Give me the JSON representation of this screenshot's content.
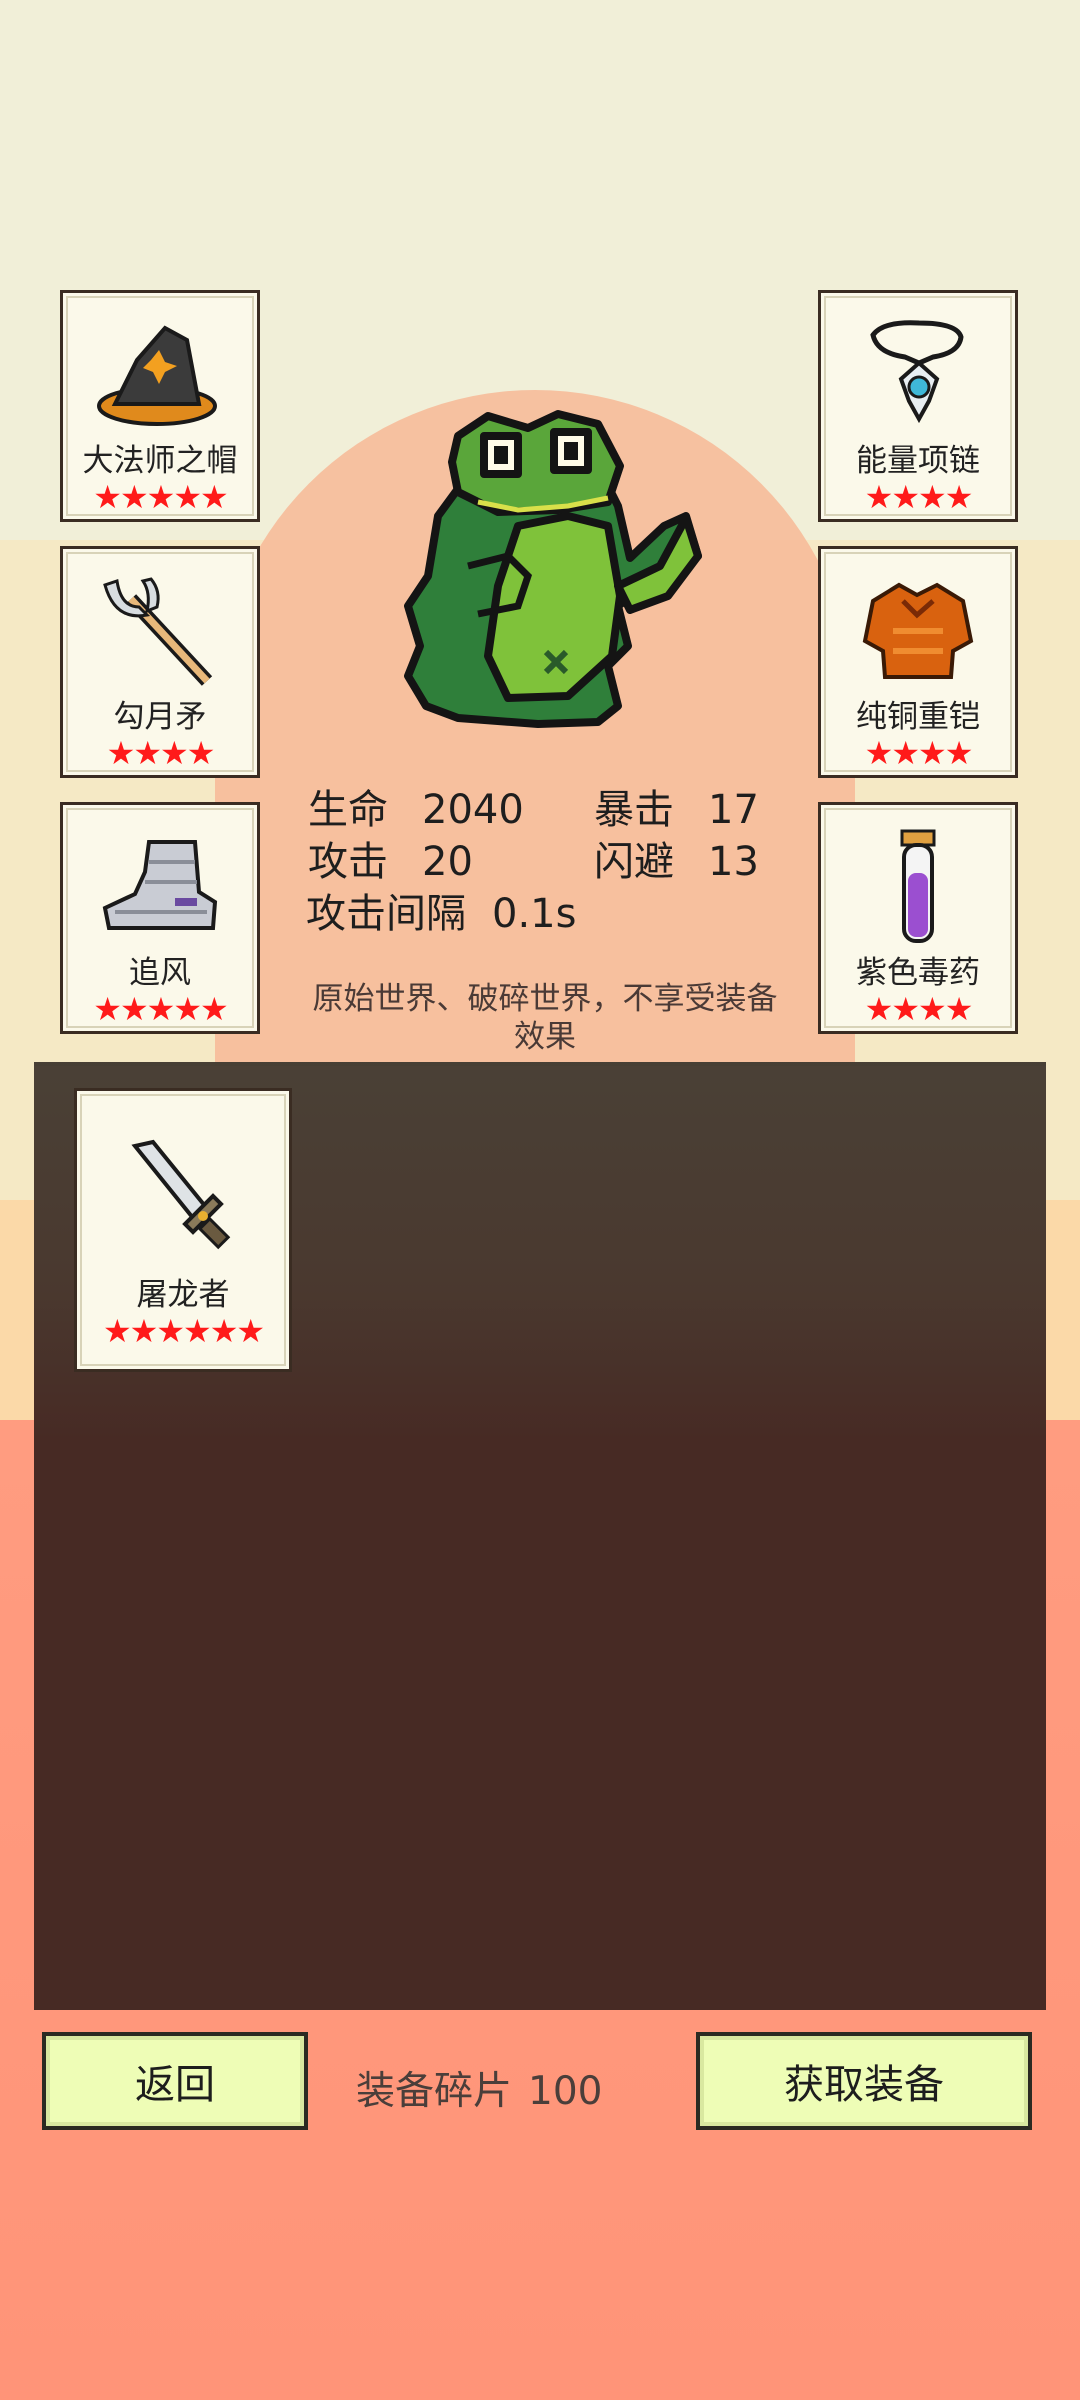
{
  "left_cards": [
    {
      "name": "大法师之帽",
      "stars": "★★★★★",
      "icon": "wizard-hat-icon"
    },
    {
      "name": "勾月矛",
      "stars": "★★★★",
      "icon": "crescent-spear-icon"
    },
    {
      "name": "追风",
      "stars": "★★★★★",
      "icon": "armored-boot-icon"
    }
  ],
  "right_cards": [
    {
      "name": "能量项链",
      "stars": "★★★★",
      "icon": "necklace-icon"
    },
    {
      "name": "纯铜重铠",
      "stars": "★★★★",
      "icon": "copper-armor-icon"
    },
    {
      "name": "紫色毒药",
      "stars": "★★★★",
      "icon": "purple-potion-icon"
    }
  ],
  "stats": {
    "hp_label": "生命",
    "hp": "2040",
    "crit_label": "暴击",
    "crit": "17",
    "atk_label": "攻击",
    "atk": "20",
    "dodge_label": "闪避",
    "dodge": "13",
    "interval_label": "攻击间隔",
    "interval": "0.1s"
  },
  "note": "原始世界、破碎世界，不享受装备效果",
  "inventory": [
    {
      "name": "屠龙者",
      "stars": "★★★★★★",
      "icon": "sword-icon"
    }
  ],
  "footer": {
    "back_label": "返回",
    "fragments_label": "装备碎片",
    "fragments_count": "100",
    "get_equipment_label": "获取装备"
  },
  "colors": {
    "star": "#ff1a1a",
    "button_bg": "#eefdb6",
    "panel_bg": "#472a24",
    "frog_green": "#3d8f3a"
  }
}
